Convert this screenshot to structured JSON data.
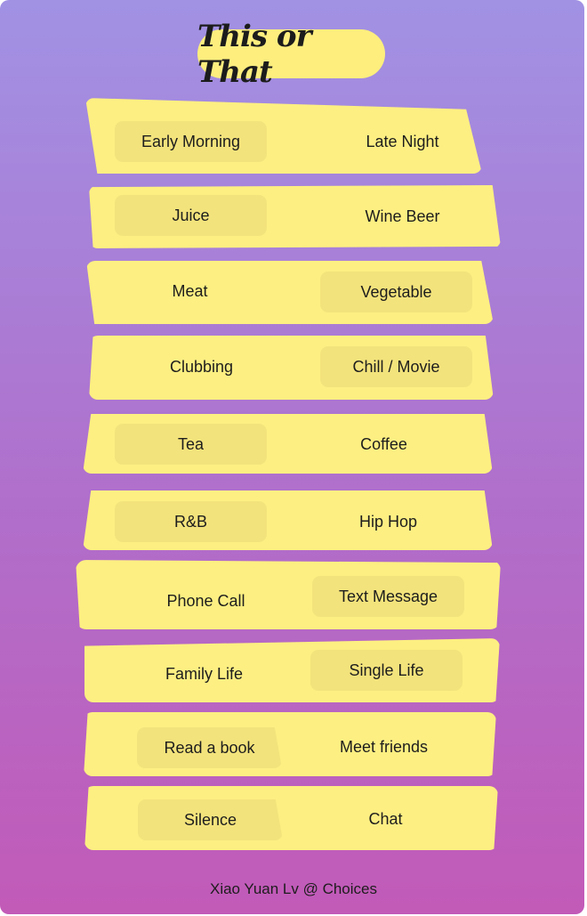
{
  "title": "This or That",
  "rows": [
    {
      "left": "Early Morning",
      "right": "Late Night",
      "selected": "left"
    },
    {
      "left": "Juice",
      "right": "Wine Beer",
      "selected": "left"
    },
    {
      "left": "Meat",
      "right": "Vegetable",
      "selected": "right"
    },
    {
      "left": "Clubbing",
      "right": "Chill / Movie",
      "selected": "right"
    },
    {
      "left": "Tea",
      "right": "Coffee",
      "selected": "left"
    },
    {
      "left": "R&B",
      "right": "Hip Hop",
      "selected": "left"
    },
    {
      "left": "Phone Call",
      "right": "Text Message",
      "selected": "right"
    },
    {
      "left": "Family Life",
      "right": "Single Life",
      "selected": "right"
    },
    {
      "left": "Read a book",
      "right": "Meet friends",
      "selected": "left"
    },
    {
      "left": "Silence",
      "right": "Chat",
      "selected": "left"
    }
  ],
  "footer": "Xiao Yuan Lv @ Choices",
  "colors": {
    "gradient_top": "#a192e4",
    "gradient_bottom": "#c25ab8",
    "card_yellow": "#fdef82",
    "selected_yellow": "#f3e37c",
    "text": "#1d1d1d"
  }
}
